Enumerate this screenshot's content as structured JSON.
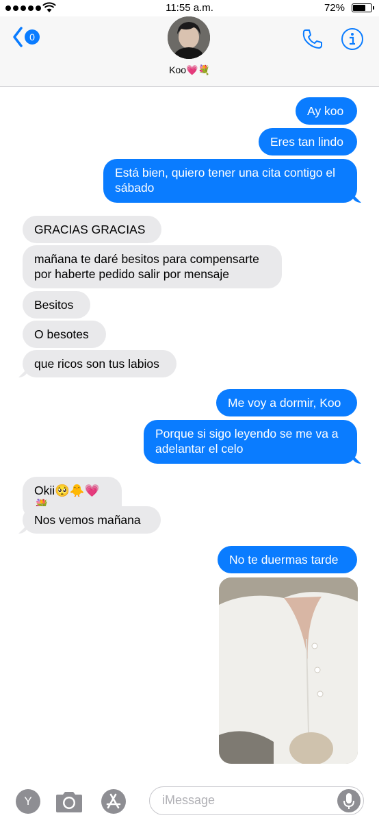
{
  "status_bar": {
    "time": "11:55 a.m.",
    "battery_percent": "72%",
    "battery_level": 0.72
  },
  "header": {
    "back_badge": "0",
    "contact_name": "Koo💗💐"
  },
  "messages": [
    {
      "direction": "sent",
      "text": "Ay koo"
    },
    {
      "direction": "sent",
      "text": "Eres tan lindo"
    },
    {
      "direction": "sent",
      "text": "Está bien, quiero tener una cita contigo el\nsábado"
    },
    {
      "direction": "received",
      "text": "GRACIAS GRACIAS"
    },
    {
      "direction": "received",
      "text": "mañana te daré besitos para compensarte\npor haberte pedido salir por mensaje"
    },
    {
      "direction": "received",
      "text": "Besitos"
    },
    {
      "direction": "received",
      "text": "O besotes"
    },
    {
      "direction": "received",
      "text": "que ricos son tus labios"
    },
    {
      "direction": "sent",
      "text": "Me voy a dormir, Koo"
    },
    {
      "direction": "sent",
      "text": "Porque si sigo leyendo se me va a\nadelantar el celo"
    },
    {
      "direction": "received",
      "text": "Okii🥺🐥💗💐"
    },
    {
      "direction": "received",
      "text": "Nos vemos mañana"
    },
    {
      "direction": "sent",
      "text": "No te duermas tarde"
    }
  ],
  "input_bar": {
    "app_button_label": "Y",
    "placeholder": "iMessage",
    "value": ""
  },
  "colors": {
    "sent_bubble": "#0a7cff",
    "received_bubble": "#e9e9eb",
    "accent": "#0a7cff"
  }
}
